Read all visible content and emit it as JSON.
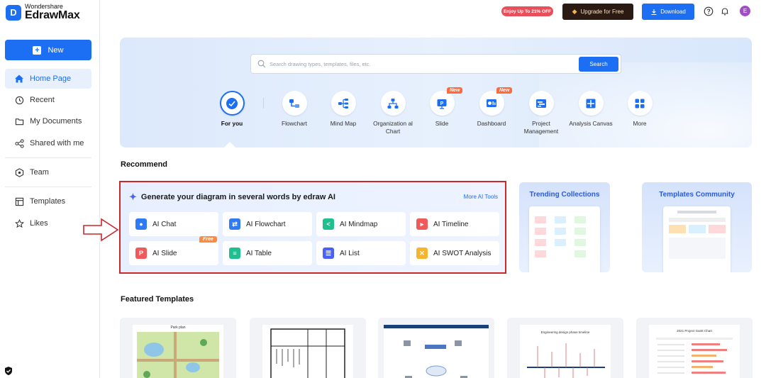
{
  "app": {
    "brand_small": "Wondershare",
    "brand_big": "EdrawMax",
    "logo_glyph": "D"
  },
  "sidebar": {
    "new_label": "New",
    "items": [
      {
        "label": "Home Page",
        "icon": "home-icon",
        "active": true
      },
      {
        "label": "Recent",
        "icon": "clock-icon"
      },
      {
        "label": "My Documents",
        "icon": "folder-icon"
      },
      {
        "label": "Shared with me",
        "icon": "share-icon"
      },
      {
        "label": "Team",
        "icon": "team-icon"
      },
      {
        "label": "Templates",
        "icon": "templates-icon"
      },
      {
        "label": "Likes",
        "icon": "star-icon"
      }
    ]
  },
  "topbar": {
    "promo": "Enjoy Up To 21% OFF",
    "upgrade": "Upgrade for Free",
    "download": "Download",
    "avatar_initial": "E"
  },
  "hero": {
    "search_placeholder": "Search drawing types, templates, files, etc.",
    "search_button": "Search",
    "categories": [
      {
        "label": "For you",
        "icon": "for-you-icon",
        "selected": true
      },
      {
        "label": "Flowchart",
        "icon": "flowchart-icon"
      },
      {
        "label": "Mind Map",
        "icon": "mind-map-icon"
      },
      {
        "label": "Organization al Chart",
        "icon": "org-chart-icon"
      },
      {
        "label": "Slide",
        "icon": "slide-icon",
        "badge": "New"
      },
      {
        "label": "Dashboard",
        "icon": "dashboard-icon",
        "badge": "New"
      },
      {
        "label": "Project Management",
        "icon": "project-icon"
      },
      {
        "label": "Analysis Canvas",
        "icon": "analysis-icon"
      },
      {
        "label": "More",
        "icon": "more-icon"
      }
    ]
  },
  "recommend": {
    "title": "Recommend",
    "ai_heading": "Generate your diagram in several words by edraw AI",
    "more_ai": "More AI Tools",
    "ai_tools": [
      {
        "label": "AI Chat",
        "color": "#2f7af5",
        "glyph": "•"
      },
      {
        "label": "AI Flowchart",
        "color": "#2f7af5",
        "glyph": "⇄"
      },
      {
        "label": "AI Mindmap",
        "color": "#1fbf8f",
        "glyph": "<"
      },
      {
        "label": "AI Timeline",
        "color": "#f05a5a",
        "glyph": "▸"
      },
      {
        "label": "AI Slide",
        "color": "#f05a5a",
        "glyph": "P",
        "badge": "Free"
      },
      {
        "label": "AI Table",
        "color": "#1fbf8f",
        "glyph": "≡"
      },
      {
        "label": "AI List",
        "color": "#4a61f5",
        "glyph": "☰"
      },
      {
        "label": "AI SWOT Analysis",
        "color": "#f5b52f",
        "glyph": "✕"
      }
    ],
    "cards": [
      {
        "title": "Trending Collections"
      },
      {
        "title": "Templates Community"
      }
    ]
  },
  "featured": {
    "title": "Featured Templates",
    "previews": [
      "Park plan",
      "",
      "",
      "Engineering design phase timeline",
      "2021 Project Gantt Chart"
    ]
  }
}
